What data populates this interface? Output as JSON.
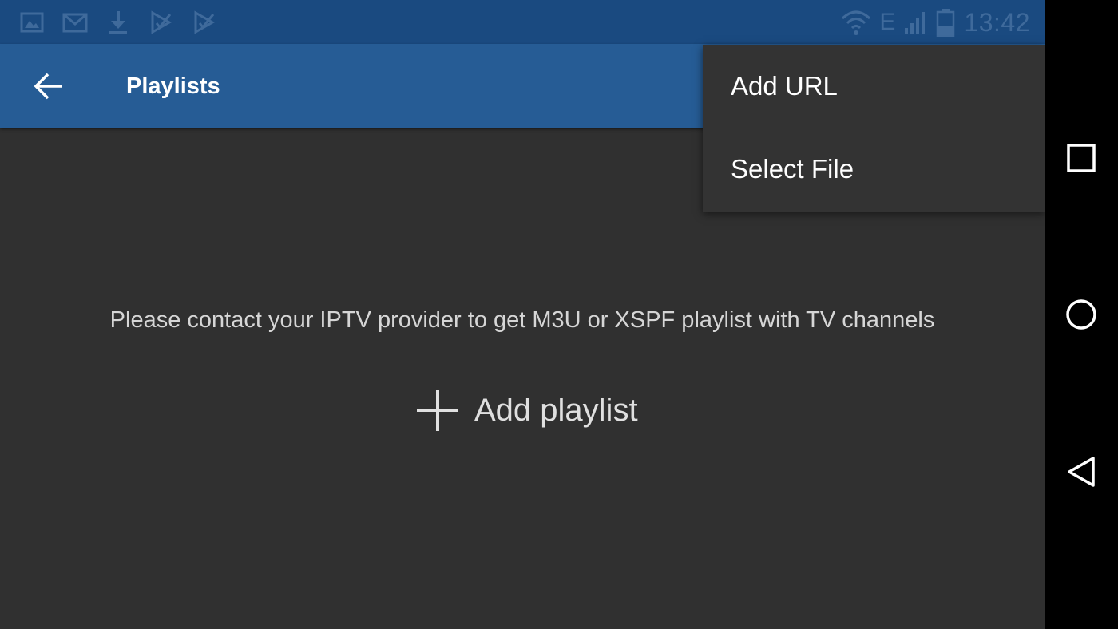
{
  "status_bar": {
    "time": "13:42",
    "network_type": "E",
    "notification_icons": [
      "gallery-icon",
      "gmail-icon",
      "download-icon",
      "play-store-icon",
      "play-store-icon"
    ],
    "colors": {
      "background": "#1a4a80",
      "icon": "#3f6a9b"
    }
  },
  "toolbar": {
    "title": "Playlists",
    "back_icon": "arrow-back-icon",
    "color": "#265c95"
  },
  "content": {
    "message": "Please contact your IPTV provider to get M3U or XSPF playlist with TV channels",
    "add_playlist_label": "Add playlist",
    "add_icon": "plus-icon",
    "background": "#303030"
  },
  "menu": {
    "items": [
      {
        "label": "Add URL"
      },
      {
        "label": "Select File"
      }
    ]
  },
  "nav_bar": {
    "buttons": [
      "recent-apps-icon",
      "home-icon",
      "back-icon"
    ]
  }
}
